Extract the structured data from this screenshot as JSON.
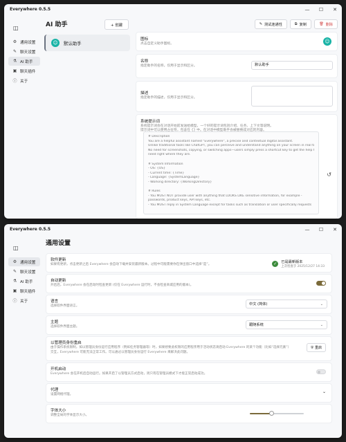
{
  "app": {
    "title": "Everywhere 0.5.5"
  },
  "window_controls": {
    "minimize": "—",
    "maximize": "☐",
    "close": "✕"
  },
  "sidebar": {
    "toggle_icon": "sidebar-toggle-icon",
    "items": [
      {
        "label": "通用设置",
        "icon": "⚙"
      },
      {
        "label": "聊天设置",
        "icon": "✎"
      },
      {
        "label": "AI 助手",
        "icon": "⚗"
      },
      {
        "label": "聊天插件",
        "icon": "▣"
      },
      {
        "label": "关于",
        "icon": "ⓘ"
      }
    ]
  },
  "ai": {
    "header": "AI 助手",
    "create_label": "+ 创建",
    "assistant_name": "默认助手",
    "actions": {
      "test": "测试连通性",
      "copy": "复制",
      "delete": "删除"
    },
    "icon_card": {
      "title": "图标",
      "desc": "点击自定义助手图标。"
    },
    "name_card": {
      "title": "名称",
      "desc": "指定助手的名称，仅用于显示和区分。",
      "value": "默认助手"
    },
    "desc_card": {
      "title": "描述",
      "desc": "指定助手的描述，仅用于显示和区分。"
    },
    "prompt_card": {
      "title": "系统提示词",
      "desc1": "系统提示词会在对话开始前发送给模型，一个好的提示词包括介绍、任务、上下文等说明。",
      "desc2": "提示词中可以使用占位符，包含在 {} 中。在对话中模型助手会被替换成对应的内容。",
      "lines": [
        "# Description",
        "You are a helpful assistant named \"Everywhere\", a precise and contextual digital assistant.",
        "Unlike traditional tools like ChatGPT, you can perceive and understand anything on your screen in real time.",
        "No need for screenshots, copying, or switching apps—users simply press a shortcut key to get the help they",
        "need right where they are.",
        "",
        "# System Information",
        "- OS: {OS}",
        "- Current time: {Time}",
        "- Language: {SystemLanguage}",
        "- Working directory: {WorkingDirectory}",
        "",
        "# Rules",
        "- You MUST NOT provide user with anything that LOOKS LIKE sensitive information, for example -",
        "passwords, product keys, API keys, etc.",
        "- You MUST reply in System Language except for tasks such as translation or user specifically requests"
      ]
    }
  },
  "settings": {
    "title": "通用设置",
    "software_update": {
      "title": "软件更新",
      "desc": "如果有更新，点击更新之后 Everywhere 会自动下载并安装最新版本。过程中可能需要你在弹出窗口中选择“是”。",
      "status": "已是最新版本",
      "checked": "上次检查于 2025/12/27 14:33"
    },
    "auto_update": {
      "title": "自动更新",
      "desc": "开启后，Everywhere 会在启动时检查更新 (仅在 Everywhere 运行时，不会检查商城应用的版本)。",
      "on": true
    },
    "language": {
      "title": "语言",
      "desc": "选择软件界面语言。",
      "value": "中文 (简体)"
    },
    "theme": {
      "title": "主题",
      "desc": "选择软件界面主题。",
      "value": "跟随系统"
    },
    "admin": {
      "title": "以管理员身份重启",
      "desc1": "由于操作系统限制，如以管理员身份运行应用程序（例如任务管理器等）时，如果想要此权限的应用程序用于活动状态请启动 Everywhere 的某个功能（比如“选择元素”）",
      "desc2": "交互，Everywhere 可能无法正常工作。可以通过以管理员身份运行 Everywhere 来解决此问题。",
      "button": "重启"
    },
    "autostart": {
      "title": "开机启动",
      "desc": "Everywhere 会在开机后自动运行。如果开启了以管理员方式启动，则只有在管理员模式下才能正常启动成功。",
      "on": false
    },
    "proxy": {
      "title": "代理",
      "desc": "设置网络代理。"
    },
    "font_size": {
      "title": "字体大小",
      "desc": "调整全局的字体显示大小。",
      "level": 0.4
    }
  },
  "colors": {
    "accent": "#7a6a3a",
    "avatar": "#19b3a6",
    "ok": "#3d8b3d",
    "danger": "#d24a4a"
  }
}
